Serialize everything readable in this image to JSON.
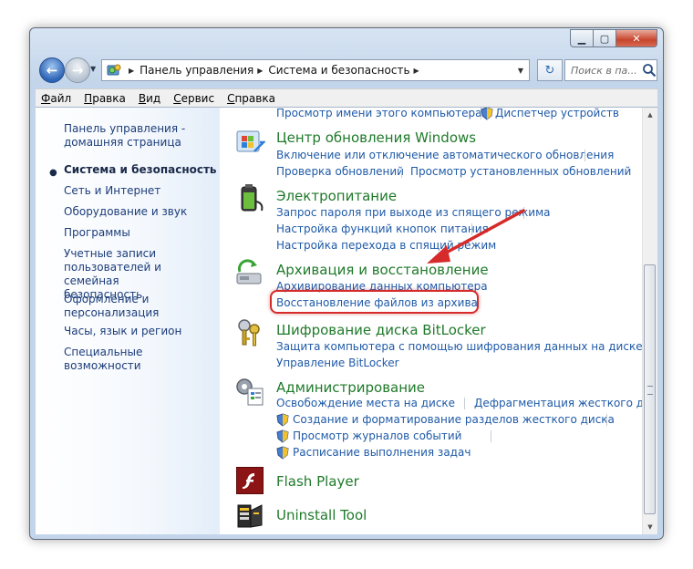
{
  "address": {
    "crumbs": [
      "Панель управления",
      "Система и безопасность"
    ]
  },
  "search": {
    "placeholder": "Поиск в па..."
  },
  "menu": [
    {
      "label": "Файл",
      "underline": "Ф",
      "rest": "айл"
    },
    {
      "label": "Правка",
      "underline": "П",
      "rest": "равка"
    },
    {
      "label": "Вид",
      "underline": "В",
      "rest": "ид"
    },
    {
      "label": "Сервис",
      "underline": "С",
      "rest": "ервис"
    },
    {
      "label": "Справка",
      "underline": "С",
      "rest": "правка"
    }
  ],
  "sidebar": {
    "home_line1": "Панель управления -",
    "home_line2": "домашняя страница",
    "items": [
      {
        "label": "Система и безопасность"
      },
      {
        "label": "Сеть и Интернет"
      },
      {
        "label": "Оборудование и звук"
      },
      {
        "label": "Программы"
      },
      {
        "label": "Учетные записи",
        "line2": "пользователей и семейная",
        "line3": "безопасность"
      },
      {
        "label": "Оформление и",
        "line2": "персонализация"
      },
      {
        "label": "Часы, язык и регион"
      },
      {
        "label": "Специальные возможности"
      }
    ]
  },
  "categories": {
    "system_partial": {
      "task1": "Просмотр имени этого компьютера",
      "task2": "Диспетчер устройств"
    },
    "windows_update": {
      "title": "Центр обновления Windows",
      "task1": "Включение или отключение автоматического обновления",
      "task2": "Проверка обновлений",
      "task3": "Просмотр установленных обновлений"
    },
    "power": {
      "title": "Электропитание",
      "task1": "Запрос пароля при выходе из спящего режима",
      "task2": "Настройка функций кнопок питания",
      "task3": "Настройка перехода в спящий режим"
    },
    "backup": {
      "title": "Архивация и восстановление",
      "task1": "Архивирование данных компьютера",
      "task2": "Восстановление файлов из архива"
    },
    "bitlocker": {
      "title": "Шифрование диска BitLocker",
      "task1": "Защита компьютера с помощью шифрования данных на диске",
      "task2": "Управление BitLocker"
    },
    "admin": {
      "title": "Администрирование",
      "task1": "Освобождение места на диске",
      "task2": "Дефрагментация жесткого диска",
      "task3": "Создание и форматирование разделов жесткого диска",
      "task4": "Просмотр журналов событий",
      "task5": "Расписание выполнения задач"
    },
    "flash": {
      "title": "Flash Player"
    },
    "uninstall": {
      "title": "Uninstall Tool"
    }
  },
  "icons": {
    "back": "back-arrow-icon",
    "forward": "forward-arrow-icon",
    "control_panel": "control-panel-icon",
    "refresh": "refresh-icon",
    "search": "magnifier-icon",
    "shield": "uac-shield-icon",
    "windows_update": "windows-update-icon",
    "power": "battery-icon",
    "backup": "backup-icon",
    "bitlocker": "keys-icon",
    "admin": "admin-tools-icon",
    "flash": "flash-player-icon",
    "uninstall": "uninstall-tool-icon"
  },
  "colors": {
    "category": "#1f7a2a",
    "link": "#1f5aa8",
    "annotation": "#d52b2b"
  }
}
